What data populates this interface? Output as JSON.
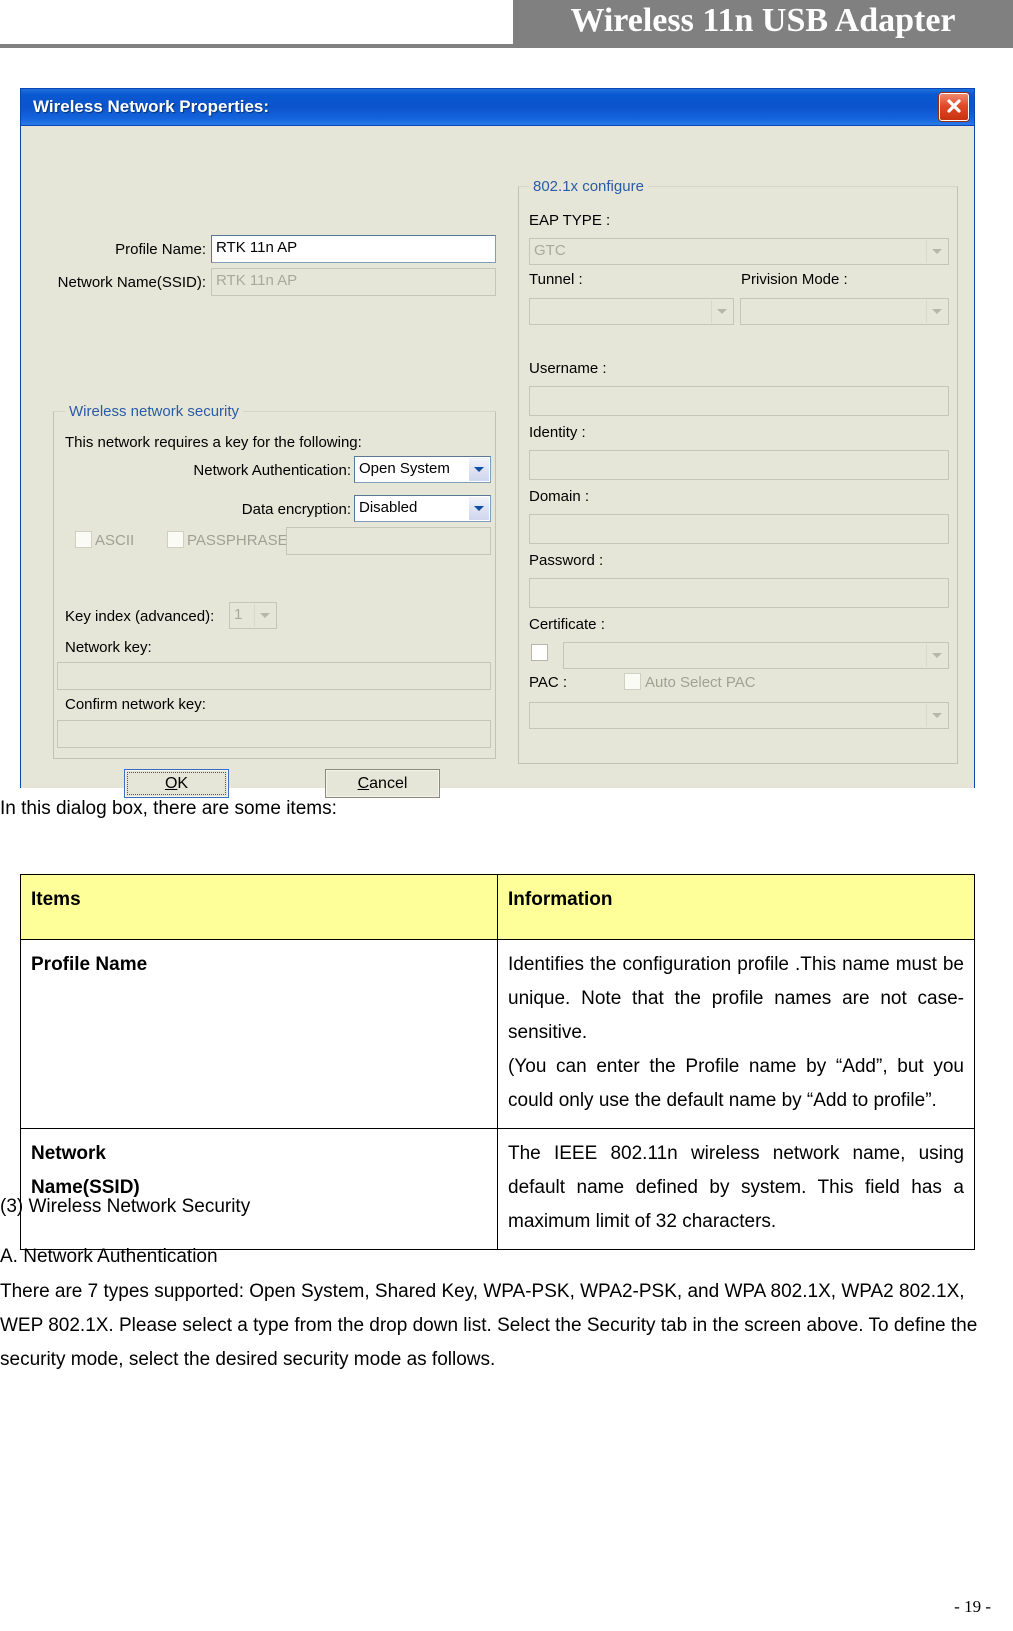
{
  "header": {
    "title": "Wireless 11n USB Adapter"
  },
  "dialog": {
    "title": "Wireless Network Properties:",
    "close_icon": "close-icon",
    "profile_name_label": "Profile Name:",
    "profile_name_value": "RTK 11n AP",
    "ssid_label": "Network Name(SSID):",
    "ssid_value": "RTK 11n AP",
    "security_group": {
      "caption": "Wireless network security",
      "requires_key_text": "This network requires a key for the following:",
      "network_auth_label": "Network Authentication:",
      "network_auth_value": "Open System",
      "data_encryption_label": "Data encryption:",
      "data_encryption_value": "Disabled",
      "ascii_label": "ASCII",
      "passphrase_label": "PASSPHRASE",
      "passphrase_value": "",
      "key_index_label": "Key index (advanced):",
      "key_index_value": "1",
      "network_key_label": "Network key:",
      "network_key_value": "",
      "confirm_key_label": "Confirm network key:",
      "confirm_key_value": ""
    },
    "dot1x_group": {
      "caption": "802.1x configure",
      "eap_type_label": "EAP TYPE :",
      "eap_type_value": "GTC",
      "tunnel_label": "Tunnel :",
      "tunnel_value": "",
      "provision_mode_label": "Privision Mode :",
      "provision_mode_value": "",
      "username_label": "Username :",
      "username_value": "",
      "identity_label": "Identity :",
      "identity_value": "",
      "domain_label": "Domain :",
      "domain_value": "",
      "password_label": "Password :",
      "password_value": "",
      "certificate_label": "Certificate :",
      "certificate_value": "",
      "pac_label": "PAC :",
      "auto_select_pac_label": "Auto Select PAC",
      "pac_value": ""
    },
    "ok_button": "OK",
    "ok_button_accel": "O",
    "ok_button_rest": "K",
    "cancel_button_accel": "C",
    "cancel_button_rest": "ancel"
  },
  "body": {
    "intro": "In this dialog box, there are some items:",
    "table": {
      "headers": [
        "Items",
        "Information"
      ],
      "rows": [
        {
          "item": "Profile Name",
          "lines": [
            "Identifies the configuration profile .This name must be unique. Note that the profile names are not case-sensitive.",
            "(You can enter the Profile name by “Add”, but you could only use the default name by “Add to profile”."
          ]
        },
        {
          "item": "Network Name(SSID)",
          "lines": [
            "The IEEE 802.11n wireless network name, using default name defined by system. This field has a maximum limit of 32 characters."
          ]
        }
      ]
    },
    "section_heading": "(3) Wireless Network Security",
    "subsection_heading": "A. Network Authentication",
    "paragraph": "There are 7 types supported: Open System, Shared Key, WPA-PSK, WPA2-PSK, and WPA 802.1X, WPA2 802.1X, WEP 802.1X. Please select a type from the drop down list. Select the Security tab in the screen above. To define the security mode, select the desired security mode as follows."
  },
  "footer": {
    "page_number": "- 19 -"
  }
}
